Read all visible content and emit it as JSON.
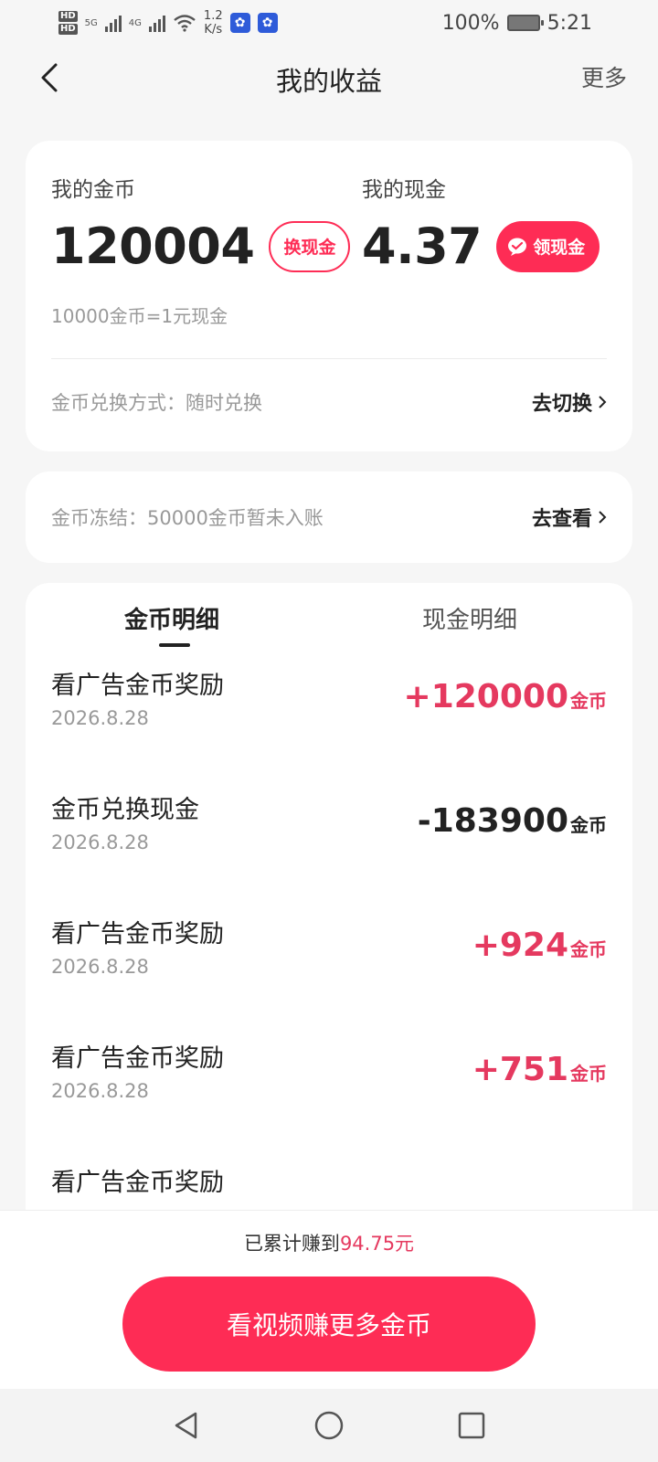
{
  "status_bar": {
    "net_speed_value": "1.2",
    "net_speed_unit": "K/s",
    "battery": "100%",
    "time": "5:21",
    "hd1": "HD",
    "hd2": "HD",
    "sig1": "5G",
    "sig2": "4G"
  },
  "header": {
    "title": "我的收益",
    "more": "更多"
  },
  "balance": {
    "coins_label": "我的金币",
    "coins_value": "120004",
    "exchange_button": "换现金",
    "cash_label": "我的现金",
    "cash_value": "4.37",
    "withdraw_button": "领现金",
    "rate": "10000金币=1元现金",
    "exchange_method": "金币兑换方式：随时兑换",
    "switch_action": "去切换"
  },
  "frozen": {
    "text": "金币冻结：50000金币暂未入账",
    "action": "去查看"
  },
  "tabs": [
    {
      "label": "金币明细",
      "active": true
    },
    {
      "label": "现金明细",
      "active": false
    }
  ],
  "transactions": [
    {
      "title": "看广告金币奖励",
      "date": "2026.8.28",
      "amount": "+120000",
      "unit": "金币",
      "sign": "plus"
    },
    {
      "title": "金币兑换现金",
      "date": "2026.8.28",
      "amount": "-183900",
      "unit": "金币",
      "sign": "minus"
    },
    {
      "title": "看广告金币奖励",
      "date": "2026.8.28",
      "amount": "+924",
      "unit": "金币",
      "sign": "plus"
    },
    {
      "title": "看广告金币奖励",
      "date": "2026.8.28",
      "amount": "+751",
      "unit": "金币",
      "sign": "plus"
    },
    {
      "title": "看广告金币奖励",
      "date": "",
      "amount": "",
      "unit": "",
      "sign": "plus"
    }
  ],
  "footer": {
    "earned_prefix": "已累计赚到",
    "earned_amount": "94.75元",
    "cta": "看视频赚更多金币"
  },
  "colors": {
    "accent": "#fe2c55",
    "plus_amount": "#e5395f",
    "background": "#f6f6f6"
  }
}
